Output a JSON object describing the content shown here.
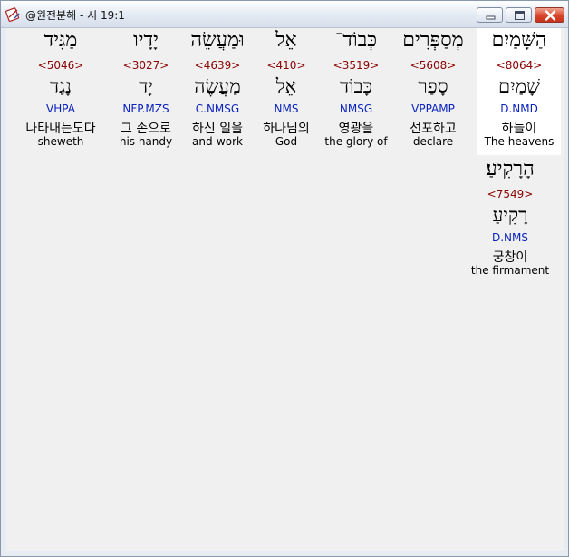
{
  "window": {
    "title": "@원전분해 - 시 19:1",
    "controls": {
      "minimize": "minimize-icon",
      "maximize": "maximize-icon",
      "close": "close-icon"
    }
  },
  "words": [
    {
      "hebrew": "הַשָּׁמַיִם",
      "strong": "<8064>",
      "lemma": "שָׁמַיִם",
      "parse": "D.NMD",
      "korean": "하늘이",
      "english": "The heavens"
    },
    {
      "hebrew": "מְסַפְּרִים",
      "strong": "<5608>",
      "lemma": "סָפַר",
      "parse": "VPPAMP",
      "korean": "선포하고",
      "english": "declare"
    },
    {
      "hebrew": "כְּבוֹד־",
      "strong": "<3519>",
      "lemma": "כָּבוֹד",
      "parse": "NMSG",
      "korean": "영광을",
      "english": "the glory of"
    },
    {
      "hebrew": "אֵל",
      "strong": "<410>",
      "lemma": "אֵל",
      "parse": "NMS",
      "korean": "하나님의",
      "english": "God"
    },
    {
      "hebrew": "וּמַעֲשֵׂה",
      "strong": "<4639>",
      "lemma": "מַעֲשֶׂה",
      "parse": "C.NMSG",
      "korean": "하신 일을",
      "english": "and-work"
    },
    {
      "hebrew": "יָדָיו",
      "strong": "<3027>",
      "lemma": "יָד",
      "parse": "NFP.MZS",
      "korean": "그 손으로",
      "english": "his handy"
    },
    {
      "hebrew": "מַגִּיד",
      "strong": "<5046>",
      "lemma": "נָגַד",
      "parse": "VHPA",
      "korean": "나타내는도다",
      "english": "sheweth"
    },
    {
      "hebrew": "הָרָקִיעַ׃",
      "strong": "<7549>",
      "lemma": "רָקִיעַ",
      "parse": "D.NMS",
      "korean": "궁창이",
      "english": "the firmament"
    }
  ]
}
